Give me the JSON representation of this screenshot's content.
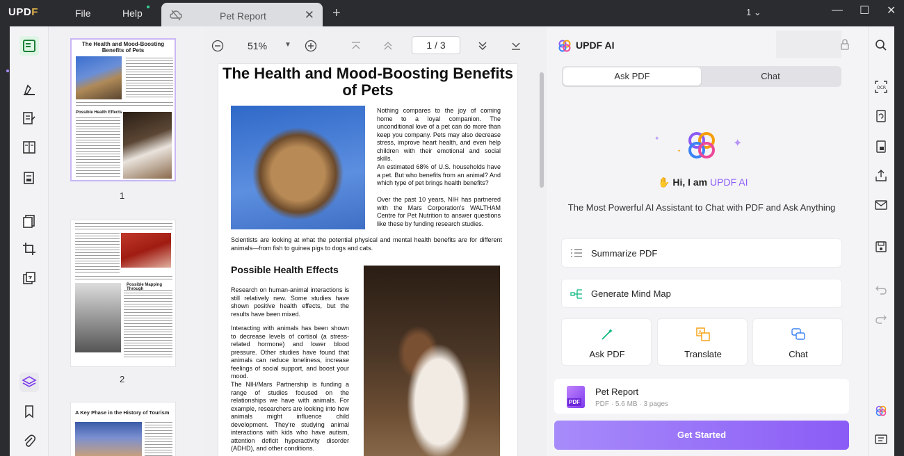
{
  "app": {
    "logo": "UPDF",
    "menu": [
      "File",
      "Help"
    ],
    "tab_title": "Pet Report",
    "page_indicator": "1"
  },
  "thumbs": {
    "page_numbers": [
      "1",
      "2"
    ],
    "p1_title": "The Health and Mood-Boosting Benefits of Pets",
    "p1_head": "Possible Health Effects",
    "p2_head": "Possible Mapping Through",
    "p3_title": "A Key Phase in the History of Tourism"
  },
  "toolbar": {
    "zoom": "51%",
    "page_current": "1",
    "page_total": "3"
  },
  "doc": {
    "title": "The Health and Mood-Boosting Benefits of Pets",
    "p1": "Nothing compares to the joy of coming home to a loyal companion. The unconditional love of a pet can do more than keep you company. Pets may also decrease stress, improve heart health, and even help children with their emotional and social skills.",
    "p2": "An estimated 68% of U.S. households have a pet. But who benefits from an animal? And which type of pet brings health benefits?",
    "p3": "Over the past 10 years, NIH has partnered with the Mars Corporation's WALTHAM Centre for Pet Nutrition to answer questions like these by funding research studies.",
    "p4": "Scientists are looking at what the potential physical and mental health benefits are for different animals—from fish to guinea pigs to dogs and cats.",
    "h2": "Possible Health Effects",
    "p5": "Research on human-animal interactions is still relatively new. Some studies have shown positive health effects, but the results have been mixed.",
    "p6": "Interacting with animals has been shown to decrease levels of cortisol (a stress-related hormone) and lower blood pressure. Other studies have found that animals can reduce loneliness, increase feelings of social support, and boost your mood.",
    "p7": "The NIH/Mars Partnership is funding a range of studies focused on the relationships we have with animals. For example, researchers are looking into how animals might influence child development. They're studying animal interactions with kids who have autism, attention deficit hyperactivity disorder (ADHD), and other conditions."
  },
  "ai": {
    "title": "UPDF AI",
    "tabs": [
      "Ask PDF",
      "Chat"
    ],
    "greeting_prefix": "Hi, I am",
    "greeting_brand": "UPDF AI",
    "tagline": "The Most Powerful AI Assistant to Chat with PDF and Ask Anything",
    "actions": [
      "Summarize PDF",
      "Generate Mind Map"
    ],
    "tiles": [
      "Ask PDF",
      "Translate",
      "Chat"
    ],
    "file_name": "Pet Report",
    "file_meta": "PDF · 5.6 MB · 3 pages",
    "file_badge": "PDF",
    "start": "Get Started"
  },
  "colors": {
    "accent": "#8b5cf6",
    "start_button": "#a78bfa",
    "titlebar": "#2b2c30"
  }
}
